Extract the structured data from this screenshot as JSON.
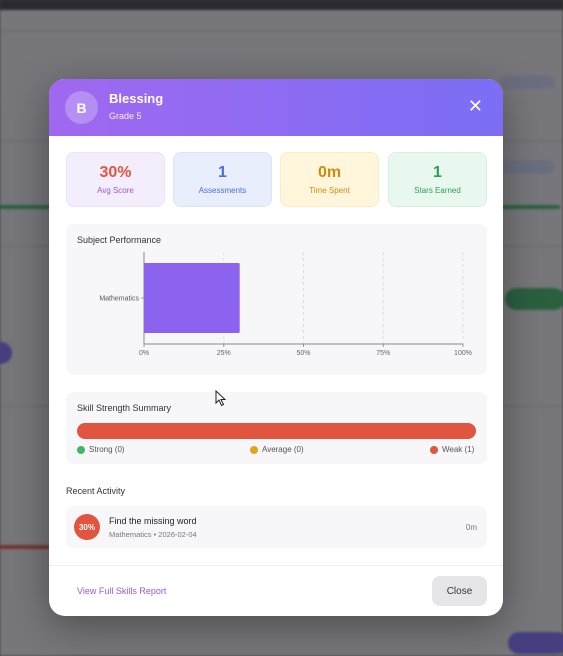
{
  "student": {
    "initial": "B",
    "name": "Blessing",
    "grade": "Grade 5"
  },
  "stats": [
    {
      "value": "30%",
      "label": "Avg Score"
    },
    {
      "value": "1",
      "label": "Assessments"
    },
    {
      "value": "0m",
      "label": "Time Spent"
    },
    {
      "value": "1",
      "label": "Stars Earned"
    }
  ],
  "subject_performance": {
    "title": "Subject Performance"
  },
  "chart_data": {
    "type": "bar",
    "orientation": "horizontal",
    "categories": [
      "Mathematics"
    ],
    "values": [
      30
    ],
    "xlim": [
      0,
      100
    ],
    "xticks": [
      "0%",
      "25%",
      "50%",
      "75%",
      "100%"
    ],
    "color": "#8b63ee",
    "grid": "vertical dashed"
  },
  "skill_summary": {
    "title": "Skill Strength Summary",
    "strong": "Strong (0)",
    "average": "Average (0)",
    "weak": "Weak (1)",
    "bar_color": "#e0553f"
  },
  "recent_activity": {
    "title": "Recent Activity",
    "items": [
      {
        "score": "30%",
        "title": "Find the missing word",
        "meta": "Mathematics • 2026-02-04",
        "duration": "0m"
      }
    ]
  },
  "footer": {
    "link": "View Full Skills Report",
    "close": "Close"
  },
  "icons": {
    "close": "close-icon"
  }
}
